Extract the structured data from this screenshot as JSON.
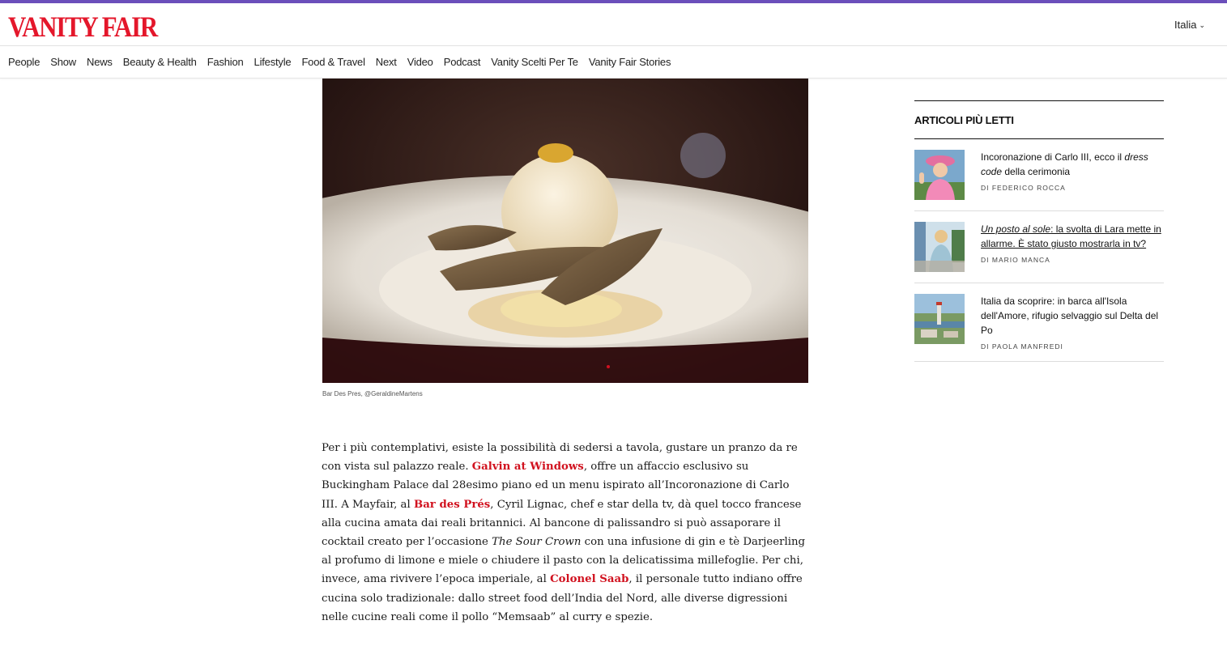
{
  "brand": {
    "logo_text": "VANITY FAIR",
    "accent_color": "#e4172b",
    "topbar_color": "#6b4fbb"
  },
  "header": {
    "language": "Italia",
    "language_icon": "chevron-down-icon"
  },
  "nav": {
    "items": [
      "People",
      "Show",
      "News",
      "Beauty & Health",
      "Fashion",
      "Lifestyle",
      "Food & Travel",
      "Next",
      "Video",
      "Podcast",
      "Vanity Scelti Per Te",
      "Vanity Fair Stories"
    ]
  },
  "hero": {
    "caption": "Bar Des Pres, @GeraldineMartens"
  },
  "article": {
    "p1_a": "Per i più contemplativi, esiste la possibilità di sedersi a tavola, gustare un pranzo da re con vista sul palazzo reale. ",
    "link_galvin": "Galvin at Windows",
    "p1_b": ", offre un affaccio esclusivo su Buckingham Palace dal 28esimo piano ed un menu ispirato all’Incoronazione di Carlo III. A Mayfair, al ",
    "link_bar": "Bar des Prés",
    "p1_c": ", Cyril Lignac, chef e star della tv, dà quel tocco francese alla cucina amata dai reali britannici. Al bancone di palissandro si può assaporare il cocktail creato per l’occasione ",
    "cocktail": "The Sour Crown",
    "p1_d": " con una infusione di gin e tè Darjeerling al profumo di limone e miele o chiudere il pasto con la delicatissima millefoglie. Per chi, invece, ama rivivere l’epoca imperiale, al ",
    "link_colonel": "Colonel Saab",
    "p1_e": ", il personale tutto indiano offre cucina solo tradizionale: dallo street food dell’India del Nord, alle diverse digressioni nelle cucine reali come il pollo “Memsaab” al curry e spezie."
  },
  "sidebar": {
    "title": "ARTICOLI PIÙ LETTI",
    "items": [
      {
        "title_a": "Incoronazione di Carlo III, ecco il ",
        "title_i": "dress code",
        "title_b": " della cerimonia",
        "author": "DI FEDERICO ROCCA"
      },
      {
        "title_i": "Un posto al sole",
        "title_b": ": la svolta di Lara mette in allarme. È stato giusto mostrarla in tv?",
        "author": "DI MARIO MANCA"
      },
      {
        "title_b": "Italia da scoprire: in barca all'Isola dell'Amore, rifugio selvaggio sul Delta del Po",
        "author": "DI PAOLA MANFREDI"
      }
    ]
  }
}
